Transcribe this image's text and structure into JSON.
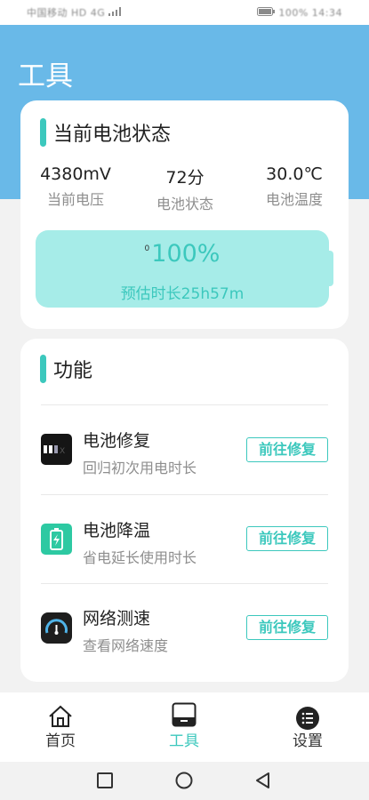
{
  "status_bar": {
    "left_text": "中国移动 HD 4G",
    "right_text": "100% 14:34"
  },
  "page_title": "工具",
  "battery_card": {
    "title": "当前电池状态",
    "stats": [
      {
        "value": "4380mV",
        "label": "当前电压"
      },
      {
        "value": "72分",
        "label": "电池状态"
      },
      {
        "value": "30.0℃",
        "label": "电池温度"
      }
    ],
    "battery": {
      "prefix": "0",
      "percent": "100%",
      "estimate": "预估时长25h57m",
      "level": 1.0
    }
  },
  "functions": {
    "title": "功能",
    "items": [
      {
        "title": "电池修复",
        "desc": "回归初次用电时长",
        "button": "前往修复",
        "icon": "battery-repair-icon"
      },
      {
        "title": "电池降温",
        "desc": "省电延长使用时长",
        "button": "前往修复",
        "icon": "battery-cool-icon"
      },
      {
        "title": "网络测速",
        "desc": "查看网络速度",
        "button": "前往修复",
        "icon": "speedometer-icon"
      }
    ]
  },
  "tabbar": {
    "tabs": [
      {
        "label": "首页",
        "icon": "home-icon"
      },
      {
        "label": "工具",
        "icon": "toolbox-icon"
      },
      {
        "label": "设置",
        "icon": "settings-list-icon"
      }
    ],
    "active": 1
  },
  "colors": {
    "accent": "#3cc8bd",
    "hero": "#69b9e8",
    "battery_fill": "#a6ece8"
  }
}
